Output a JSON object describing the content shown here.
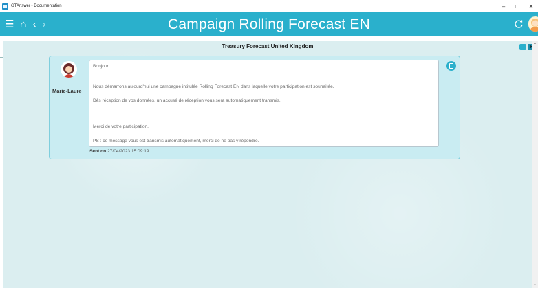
{
  "window": {
    "title": "GTAnswer - Documentation",
    "minimize": "–",
    "maximize": "□",
    "close": "✕"
  },
  "header": {
    "title": "Campaign Rolling Forecast EN",
    "menu_icon": "☰",
    "home_icon": "⌂",
    "back_icon": "‹",
    "forward_icon": "›",
    "accent": "#2ab0cc"
  },
  "section": {
    "title": "Treasury Forecast United Kingdom",
    "close_glyph": "✕"
  },
  "message": {
    "sender": "Marie-Laure",
    "lines": [
      "Bonjour,",
      "Nous démarrons aujourd'hui une campagne intitulée Rolling Forecast EN dans laquelle votre participation est souhaitée.",
      "Dès réception de vos données, un accusé de réception vous sera automatiquement transmis.",
      "Merci de votre participation.",
      "PS : ce message vous est transmis automatiquement, merci de ne pas y répondre."
    ],
    "sent_label": "Sent on",
    "sent_date": "27/04/2023 15:09:19"
  }
}
